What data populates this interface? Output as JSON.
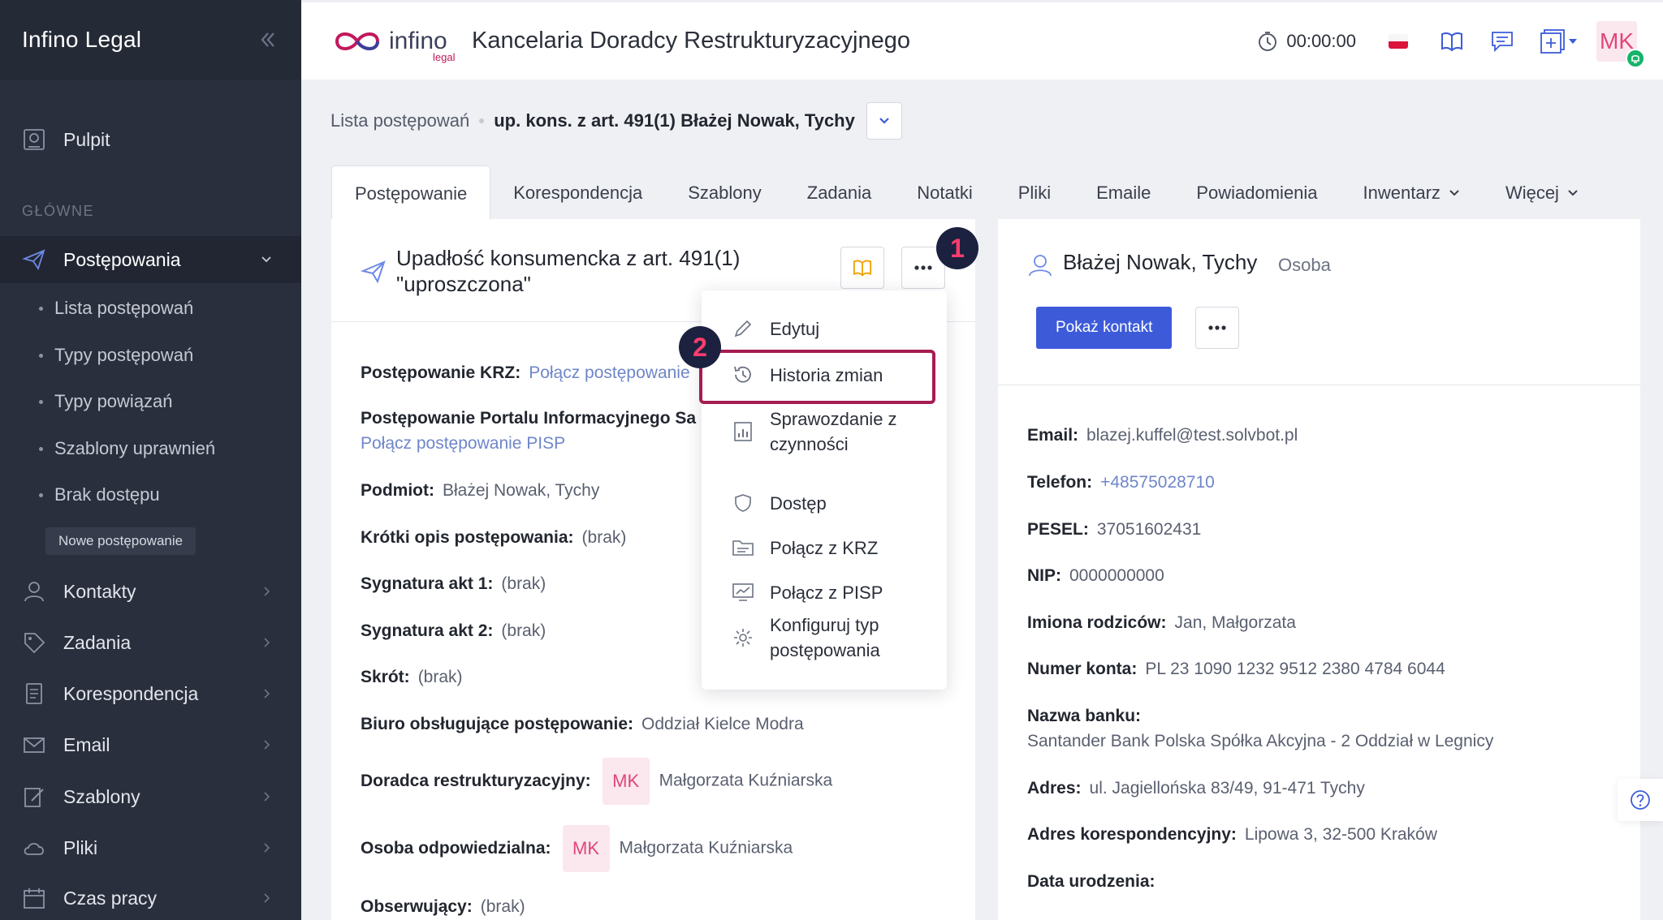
{
  "app": {
    "brand": "Infino Legal",
    "logo_text": "infino",
    "logo_sub": "legal",
    "company": "Kancelaria Doradcy Restrukturyzacyjnego"
  },
  "header": {
    "timer": "00:00:00",
    "user_initials": "MK"
  },
  "sidebar": {
    "dashboard": "Pulpit",
    "section_label": "GŁÓWNE",
    "active": "Postępowania",
    "sub_items": [
      "Lista postępowań",
      "Typy postępowań",
      "Typy powiązań",
      "Szablony uprawnień",
      "Brak dostępu"
    ],
    "new_button": "Nowe postępowanie",
    "items": [
      "Kontakty",
      "Zadania",
      "Korespondencja",
      "Email",
      "Szablony",
      "Pliki",
      "Czas pracy"
    ]
  },
  "breadcrumb": {
    "parent": "Lista postępowań",
    "current": "up. kons. z art. 491(1) Błażej Nowak, Tychy"
  },
  "tabs": [
    "Postępowanie",
    "Korespondencja",
    "Szablony",
    "Zadania",
    "Notatki",
    "Pliki",
    "Emaile",
    "Powiadomienia",
    "Inwentarz",
    "Więcej"
  ],
  "case": {
    "title_line1": "Upadłość konsumencka z art. 491(1)",
    "title_line2": "\"uproszczona\"",
    "krz_label": "Postępowanie KRZ:",
    "krz_link": "Połącz postępowanie",
    "pisp_label": "Postępowanie Portalu Informacyjnego Sa",
    "pisp_link": "Połącz postępowanie PISP",
    "podmiot_label": "Podmiot:",
    "podmiot": "Błażej Nowak, Tychy",
    "opis_label": "Krótki opis postępowania:",
    "opis": "(brak)",
    "sygn1_label": "Sygnatura akt 1:",
    "sygn1": "(brak)",
    "sygn2_label": "Sygnatura akt 2:",
    "sygn2": "(brak)",
    "skrot_label": "Skrót:",
    "skrot": "(brak)",
    "biuro_label": "Biuro obsługujące postępowanie:",
    "biuro": "Oddział Kielce Modra",
    "doradca_label": "Doradca restrukturyzacyjny:",
    "doradca_initials": "MK",
    "doradca": "Małgorzata Kuźniarska",
    "osoba_label": "Osoba odpowiedzialna:",
    "osoba_initials": "MK",
    "osoba": "Małgorzata Kuźniarska",
    "obs_label": "Obserwujący:",
    "obs": "(brak)"
  },
  "menu": {
    "items": [
      "Edytuj",
      "Historia zmian",
      "Sprawozdanie z",
      "czynności",
      "Dostęp",
      "Połącz z KRZ",
      "Połącz z PISP",
      "Konfiguruj typ",
      "postępowania"
    ],
    "step1": "1",
    "step2": "2"
  },
  "contact": {
    "name": "Błażej Nowak, Tychy",
    "type": "Osoba",
    "show_button": "Pokaż kontakt",
    "email_label": "Email:",
    "email": "blazej.kuffel@test.solvbot.pl",
    "phone_label": "Telefon:",
    "phone": "+48575028710",
    "pesel_label": "PESEL:",
    "pesel": "37051602431",
    "nip_label": "NIP:",
    "nip": "0000000000",
    "parents_label": "Imiona rodziców:",
    "parents": "Jan, Małgorzata",
    "account_label": "Numer konta:",
    "account": "PL 23 1090 1232 9512 2380 4784 6044",
    "bank_label": "Nazwa banku:",
    "bank": "Santander Bank Polska Spółka Akcyjna - 2 Oddział w Legnicy",
    "address_label": "Adres:",
    "address": "ul. Jagiellońska 83/49, 91-471 Tychy",
    "corr_label": "Adres korespondencyjny:",
    "corr": "Lipowa 3, 32-500 Kraków",
    "birth_label": "Data urodzenia:"
  },
  "colors": {
    "sidebar": "#2a2f3d",
    "primary": "#3d5bd9",
    "highlight": "#a51d52",
    "badge": "#1c2140",
    "badge_text": "#ff3d6e",
    "link": "#6f86c9"
  }
}
